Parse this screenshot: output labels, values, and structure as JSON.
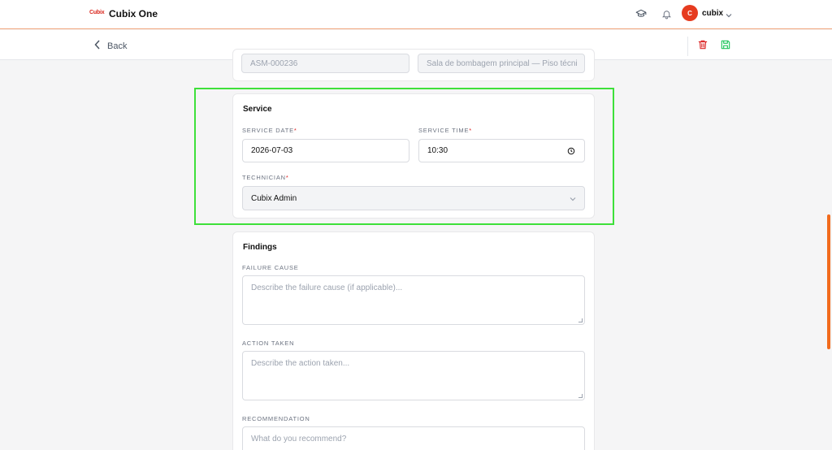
{
  "header": {
    "logo_text": "Cubix",
    "app_title": "Cubix One",
    "avatar_initial": "C",
    "user_name": "cubix",
    "accent_color": "#f26b1d"
  },
  "toolbar": {
    "back_label": "Back"
  },
  "asset_card": {
    "asset_id_value": "ASM-000236",
    "location_value": "Sala de bombagem principal — Piso técni"
  },
  "service": {
    "title": "Service",
    "date_label": "SERVICE DATE",
    "date_value": "2026-07-03",
    "time_label": "SERVICE TIME",
    "time_value": "10:30",
    "technician_label": "TECHNICIAN",
    "technician_value": "Cubix Admin",
    "required_mark": "*"
  },
  "findings": {
    "title": "Findings",
    "failure_label": "FAILURE CAUSE",
    "failure_placeholder": "Describe the failure cause (if applicable)...",
    "action_label": "ACTION TAKEN",
    "action_placeholder": "Describe the action taken...",
    "recommendation_label": "RECOMMENDATION",
    "recommendation_placeholder": "What do you recommend?"
  }
}
